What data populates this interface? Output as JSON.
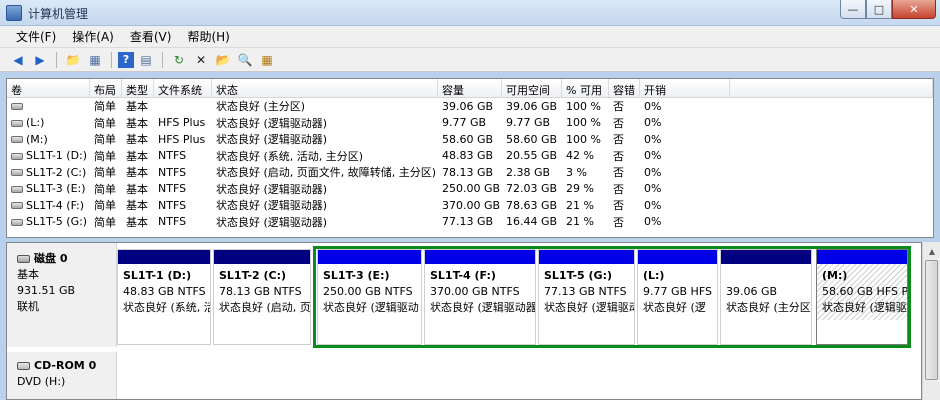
{
  "window": {
    "title": "计算机管理"
  },
  "menu": [
    "文件(F)",
    "操作(A)",
    "查看(V)",
    "帮助(H)"
  ],
  "toolbar_icons": [
    "back-icon",
    "forward-icon",
    "up-folder-icon",
    "console-tree-icon",
    "help-icon",
    "properties-icon",
    "refresh-icon",
    "delete-icon",
    "open-icon",
    "search-icon",
    "export-icon"
  ],
  "columns": [
    "卷",
    "布局",
    "类型",
    "文件系统",
    "状态",
    "容量",
    "可用空间",
    "% 可用",
    "容错",
    "开销"
  ],
  "volumes": [
    {
      "name": "",
      "layout": "简单",
      "type": "基本",
      "fs": "",
      "status": "状态良好 (主分区)",
      "capacity": "39.06 GB",
      "free": "39.06 GB",
      "pct": "100 %",
      "fault": "否",
      "overhead": "0%"
    },
    {
      "name": "(L:)",
      "layout": "简单",
      "type": "基本",
      "fs": "HFS Plus",
      "status": "状态良好 (逻辑驱动器)",
      "capacity": "9.77 GB",
      "free": "9.77 GB",
      "pct": "100 %",
      "fault": "否",
      "overhead": "0%"
    },
    {
      "name": "(M:)",
      "layout": "简单",
      "type": "基本",
      "fs": "HFS Plus",
      "status": "状态良好 (逻辑驱动器)",
      "capacity": "58.60 GB",
      "free": "58.60 GB",
      "pct": "100 %",
      "fault": "否",
      "overhead": "0%"
    },
    {
      "name": "SL1T-1 (D:)",
      "layout": "简单",
      "type": "基本",
      "fs": "NTFS",
      "status": "状态良好 (系统, 活动, 主分区)",
      "capacity": "48.83 GB",
      "free": "20.55 GB",
      "pct": "42 %",
      "fault": "否",
      "overhead": "0%"
    },
    {
      "name": "SL1T-2 (C:)",
      "layout": "简单",
      "type": "基本",
      "fs": "NTFS",
      "status": "状态良好 (启动, 页面文件, 故障转储, 主分区)",
      "capacity": "78.13 GB",
      "free": "2.38 GB",
      "pct": "3 %",
      "fault": "否",
      "overhead": "0%"
    },
    {
      "name": "SL1T-3 (E:)",
      "layout": "简单",
      "type": "基本",
      "fs": "NTFS",
      "status": "状态良好 (逻辑驱动器)",
      "capacity": "250.00 GB",
      "free": "72.03 GB",
      "pct": "29 %",
      "fault": "否",
      "overhead": "0%"
    },
    {
      "name": "SL1T-4 (F:)",
      "layout": "简单",
      "type": "基本",
      "fs": "NTFS",
      "status": "状态良好 (逻辑驱动器)",
      "capacity": "370.00 GB",
      "free": "78.63 GB",
      "pct": "21 %",
      "fault": "否",
      "overhead": "0%"
    },
    {
      "name": "SL1T-5 (G:)",
      "layout": "简单",
      "type": "基本",
      "fs": "NTFS",
      "status": "状态良好 (逻辑驱动器)",
      "capacity": "77.13 GB",
      "free": "16.44 GB",
      "pct": "21 %",
      "fault": "否",
      "overhead": "0%"
    }
  ],
  "disk0": {
    "name": "磁盘 0",
    "kind": "基本",
    "size": "931.51 GB",
    "state": "联机"
  },
  "partitions": [
    {
      "name": "SL1T-1  (D:)",
      "size": "48.83 GB NTFS",
      "status": "状态良好 (系统, 活"
    },
    {
      "name": "SL1T-2  (C:)",
      "size": "78.13 GB NTFS",
      "status": "状态良好 (启动, 页"
    },
    {
      "name": "SL1T-3  (E:)",
      "size": "250.00 GB NTFS",
      "status": "状态良好 (逻辑驱动"
    },
    {
      "name": "SL1T-4  (F:)",
      "size": "370.00 GB NTFS",
      "status": "状态良好 (逻辑驱动器)"
    },
    {
      "name": "SL1T-5  (G:)",
      "size": "77.13 GB NTFS",
      "status": "状态良好 (逻辑驱动"
    },
    {
      "name": "(L:)",
      "size": "9.77 GB HFS",
      "status": "状态良好 (逻"
    },
    {
      "name": "",
      "size": "39.06 GB",
      "status": "状态良好 (主分区"
    },
    {
      "name": "(M:)",
      "size": "58.60 GB HFS P",
      "status": "状态良好 (逻辑驱"
    }
  ],
  "cdrom": {
    "name": "CD-ROM 0",
    "drive": "DVD (H:)"
  }
}
